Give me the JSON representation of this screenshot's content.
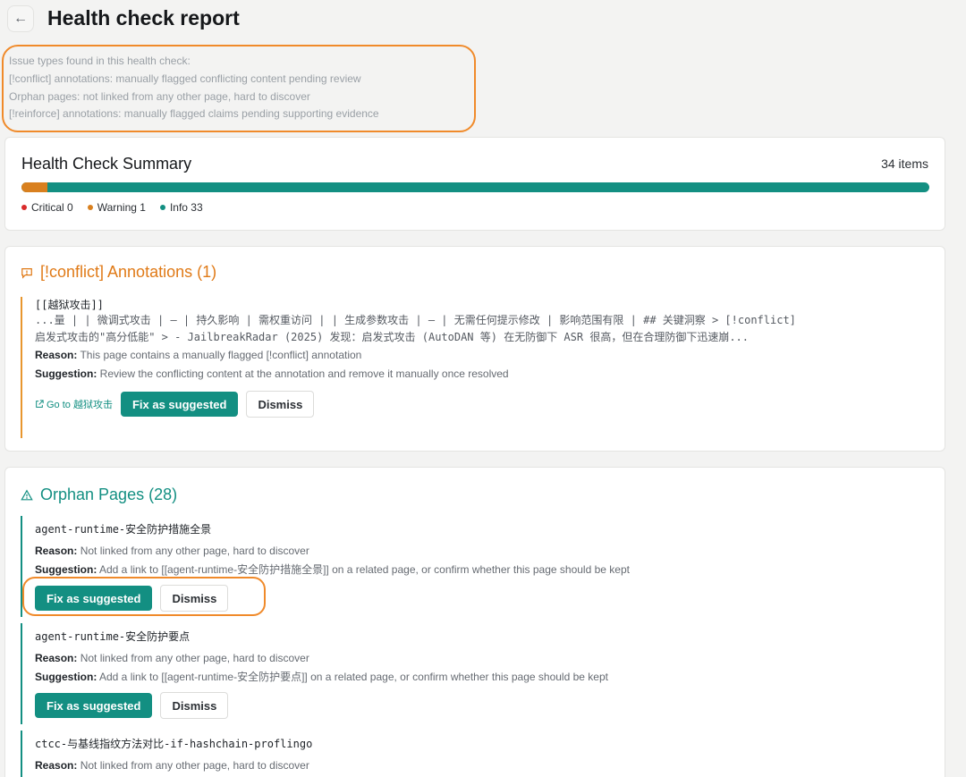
{
  "header": {
    "back_label": "←",
    "title": "Health check report"
  },
  "issue_types": {
    "heading": "Issue types found in this health check:",
    "lines": [
      "[!conflict] annotations: manually flagged conflicting content pending review",
      "Orphan pages: not linked from any other page, hard to discover",
      "[!reinforce] annotations: manually flagged claims pending supporting evidence"
    ]
  },
  "summary": {
    "title": "Health Check Summary",
    "count_label": "34 items",
    "critical_label": "Critical 0",
    "warning_label": "Warning 1",
    "info_label": "Info 33",
    "warning_fraction": 0.029,
    "colors": {
      "critical": "#d92b2b",
      "warning": "#d9801f",
      "info": "#138f82"
    }
  },
  "conflict_section": {
    "heading": "[!conflict] Annotations (1)",
    "icon": "comment-alert-icon",
    "entry": {
      "title": "[[越狱攻击]]",
      "excerpt_line1": "...量 | | 微调式攻击 | — | 持久影响 | 需权重访问 | | 生成参数攻击 | — | 无需任何提示修改 | 影响范围有限 | ## 关键洞察 > [!conflict]",
      "excerpt_line2": "启发式攻击的\"高分低能\" > - JailbreakRadar (2025) 发现：启发式攻击 (AutoDAN 等) 在无防御下 ASR 很高，但在合理防御下迅速崩...",
      "reason_label": "Reason:",
      "reason": "This page contains a manually flagged [!conflict] annotation",
      "suggestion_label": "Suggestion:",
      "suggestion": "Review the conflicting content at the annotation and remove it manually once resolved",
      "goto_label": "Go to 越狱攻击",
      "fix_label": "Fix as suggested",
      "dismiss_label": "Dismiss"
    }
  },
  "orphan_section": {
    "heading": "Orphan Pages (28)",
    "icon": "warning-triangle-icon",
    "entries": [
      {
        "title": "agent-runtime-安全防护措施全景",
        "reason_label": "Reason:",
        "reason": "Not linked from any other page, hard to discover",
        "suggestion_label": "Suggestion:",
        "suggestion": "Add a link to [[agent-runtime-安全防护措施全景]] on a related page, or confirm whether this page should be kept",
        "fix_label": "Fix as suggested",
        "dismiss_label": "Dismiss"
      },
      {
        "title": "agent-runtime-安全防护要点",
        "reason_label": "Reason:",
        "reason": "Not linked from any other page, hard to discover",
        "suggestion_label": "Suggestion:",
        "suggestion": "Add a link to [[agent-runtime-安全防护要点]] on a related page, or confirm whether this page should be kept",
        "fix_label": "Fix as suggested",
        "dismiss_label": "Dismiss"
      },
      {
        "title": "ctcc-与基线指纹方法对比-if-hashchain-proflingo",
        "reason_label": "Reason:",
        "reason": "Not linked from any other page, hard to discover"
      }
    ]
  }
}
